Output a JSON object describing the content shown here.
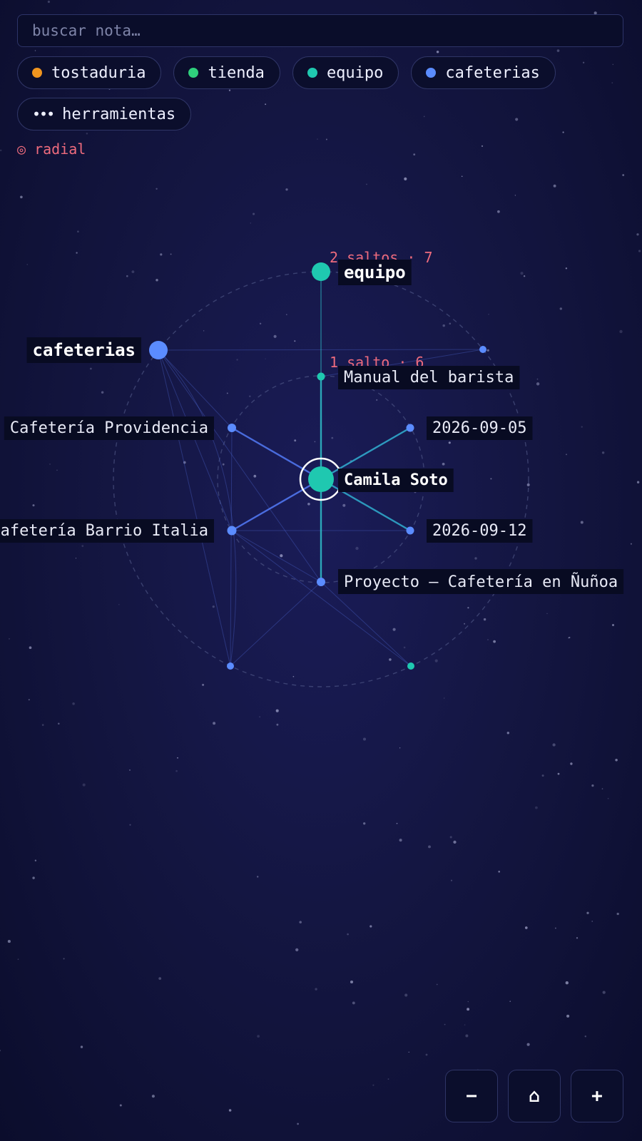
{
  "search": {
    "placeholder": "buscar nota…"
  },
  "filters": [
    {
      "label": "tostaduria",
      "color": "#f0951f"
    },
    {
      "label": "tienda",
      "color": "#2fcf7c"
    },
    {
      "label": "equipo",
      "color": "#1fc8b0"
    },
    {
      "label": "cafeterias",
      "color": "#5b8cff"
    }
  ],
  "tools_chip": {
    "label": "herramientas",
    "icon": "more-horizontal-icon"
  },
  "radial_toggle": {
    "label": "◎ radial"
  },
  "rings": {
    "hop1": "1 salto · 6",
    "hop2": "2 saltos · 7"
  },
  "graph": {
    "focus": {
      "label": "Camila Soto",
      "color": "#1fc8b0"
    },
    "nodes": [
      {
        "id": "manual",
        "label": "Manual del barista",
        "color": "#1fc8b0"
      },
      {
        "id": "d0905",
        "label": "2026-09-05",
        "color": "#5b8cff"
      },
      {
        "id": "d0912",
        "label": "2026-09-12",
        "color": "#5b8cff"
      },
      {
        "id": "proyecto",
        "label": "Proyecto — Cafetería en Ñuñoa",
        "color": "#5b8cff"
      },
      {
        "id": "italia",
        "label": "Cafetería Barrio Italia",
        "color": "#5b8cff"
      },
      {
        "id": "providencia",
        "label": "Cafetería Providencia",
        "color": "#5b8cff"
      },
      {
        "id": "equipo",
        "label": "equipo",
        "color": "#1fc8b0"
      },
      {
        "id": "cafeterias",
        "label": "cafeterias",
        "color": "#5b8cff"
      },
      {
        "id": "h2a",
        "label": "",
        "color": "#5b8cff"
      },
      {
        "id": "h2b",
        "label": "",
        "color": "#1fc8b0"
      },
      {
        "id": "h2c",
        "label": "",
        "color": "#5b8cff"
      }
    ]
  },
  "zoom_controls": {
    "minus": "−",
    "home": "⌂",
    "plus": "+"
  }
}
